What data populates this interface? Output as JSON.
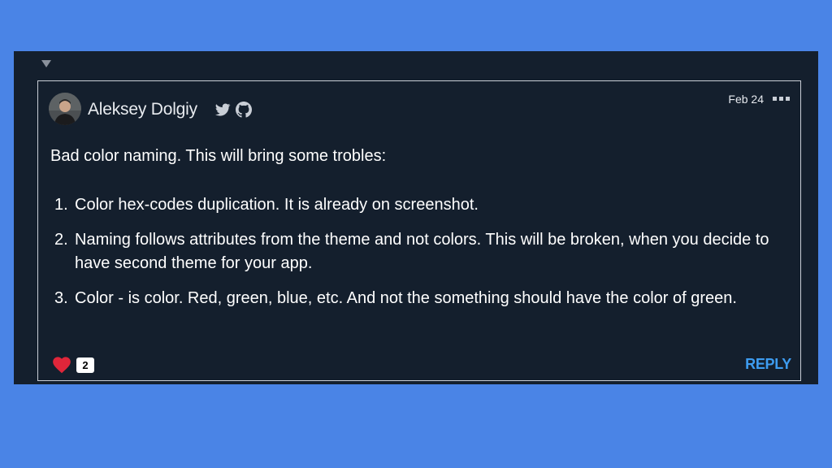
{
  "comment": {
    "author": "Aleksey Dolgiy",
    "date": "Feb 24",
    "body_intro": "Bad color naming. This will bring some trobles:",
    "list_items": [
      {
        "number": "1.",
        "text": "Color hex-codes duplication. It is already on screenshot."
      },
      {
        "number": "2.",
        "text": "Naming follows attributes from the theme and not colors. This will be broken, when you decide to have second theme for your app."
      },
      {
        "number": "3.",
        "text": "Color - is color. Red, green, blue, etc. And not the something should have the color of green."
      }
    ],
    "like_count": "2",
    "reply_label": "REPLY"
  },
  "icons": {
    "collapse": "triangle-down-icon",
    "twitter": "twitter-icon",
    "github": "github-icon",
    "more": "more-horizontal-icon",
    "like": "heart-icon"
  },
  "colors": {
    "background": "#4a84e6",
    "panel": "#141f2d",
    "border": "#c9ced6",
    "text": "#ffffff",
    "reply": "#3d9cf0",
    "heart": "#e0263a"
  }
}
